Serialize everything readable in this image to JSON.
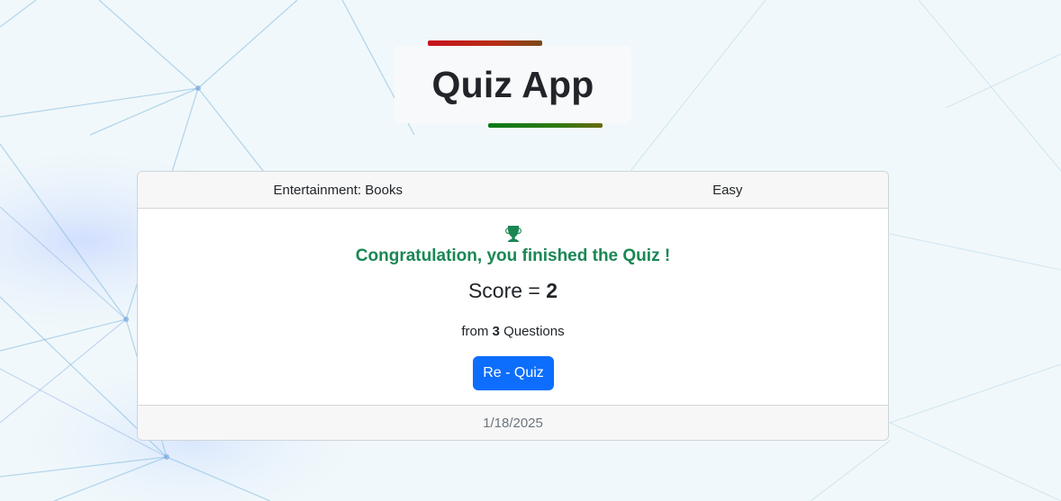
{
  "app": {
    "title": "Quiz App"
  },
  "quiz": {
    "category": "Entertainment: Books",
    "difficulty": "Easy",
    "message": "Congratulation, you finished the Quiz !",
    "score_label": "Score = ",
    "score_value": "2",
    "from_label": "from",
    "total_questions": "3",
    "questions_label": "Questions",
    "requiz_label": "Re - Quiz",
    "date": "1/18/2025"
  },
  "icons": {
    "trophy": "trophy-icon"
  },
  "colors": {
    "success": "#198754",
    "primary": "#0d6efd",
    "accent_top": "#c8121e",
    "accent_bottom": "#0b7a1a"
  }
}
